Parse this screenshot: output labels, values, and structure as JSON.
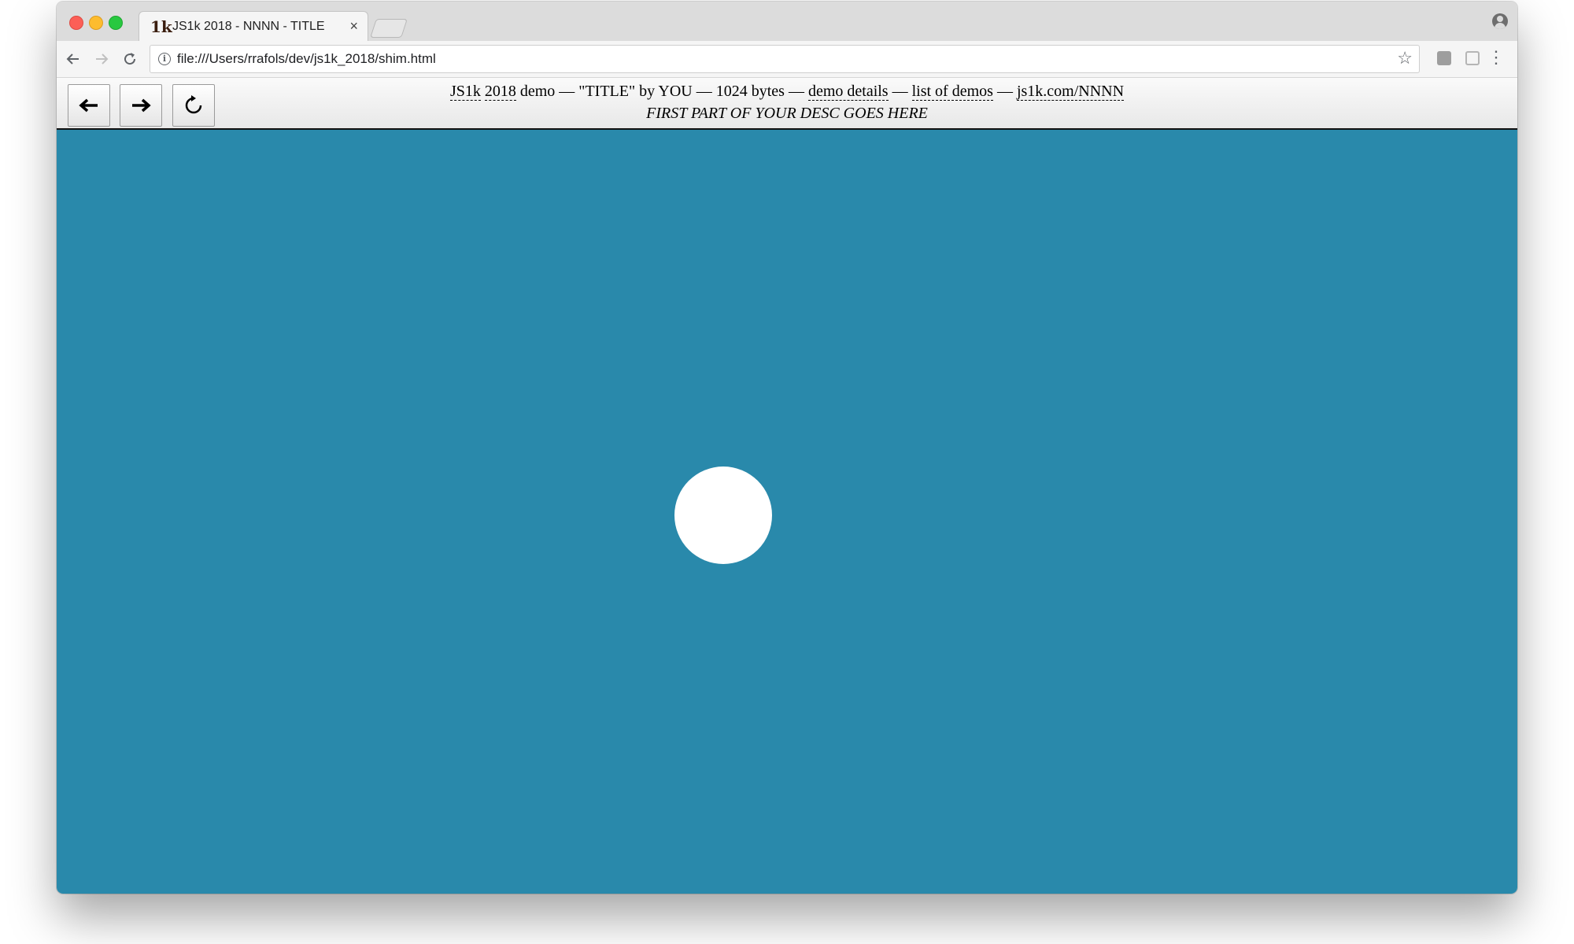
{
  "browser": {
    "tab": {
      "favicon_text": "1k",
      "title": "JS1k 2018 - NNNN - TITLE",
      "close_glyph": "×"
    },
    "address_bar": {
      "url": "file:///Users/rrafols/dev/js1k_2018/shim.html"
    },
    "icons": [
      "back-icon",
      "forward-icon",
      "reload-icon",
      "info-icon",
      "star-icon",
      "extension-icon",
      "reader-icon",
      "menu-icon",
      "profile-icon"
    ]
  },
  "shim": {
    "buttons": {
      "prev_glyph": "🡐",
      "next_glyph": "🡒",
      "restart_glyph": "↻"
    },
    "header": {
      "js1k_link": "JS1k",
      "year_link": "2018",
      "demo_text": " demo — \"TITLE\" by YOU — 1024 bytes — ",
      "details_link": "demo details",
      "sep1": " — ",
      "list_link": "list of demos",
      "sep2": " — ",
      "short_link": "js1k.com/NNNN"
    },
    "description": "FIRST PART OF YOUR DESC GOES HERE"
  },
  "canvas": {
    "background_color": "#2989ab",
    "ball_color": "#ffffff"
  }
}
